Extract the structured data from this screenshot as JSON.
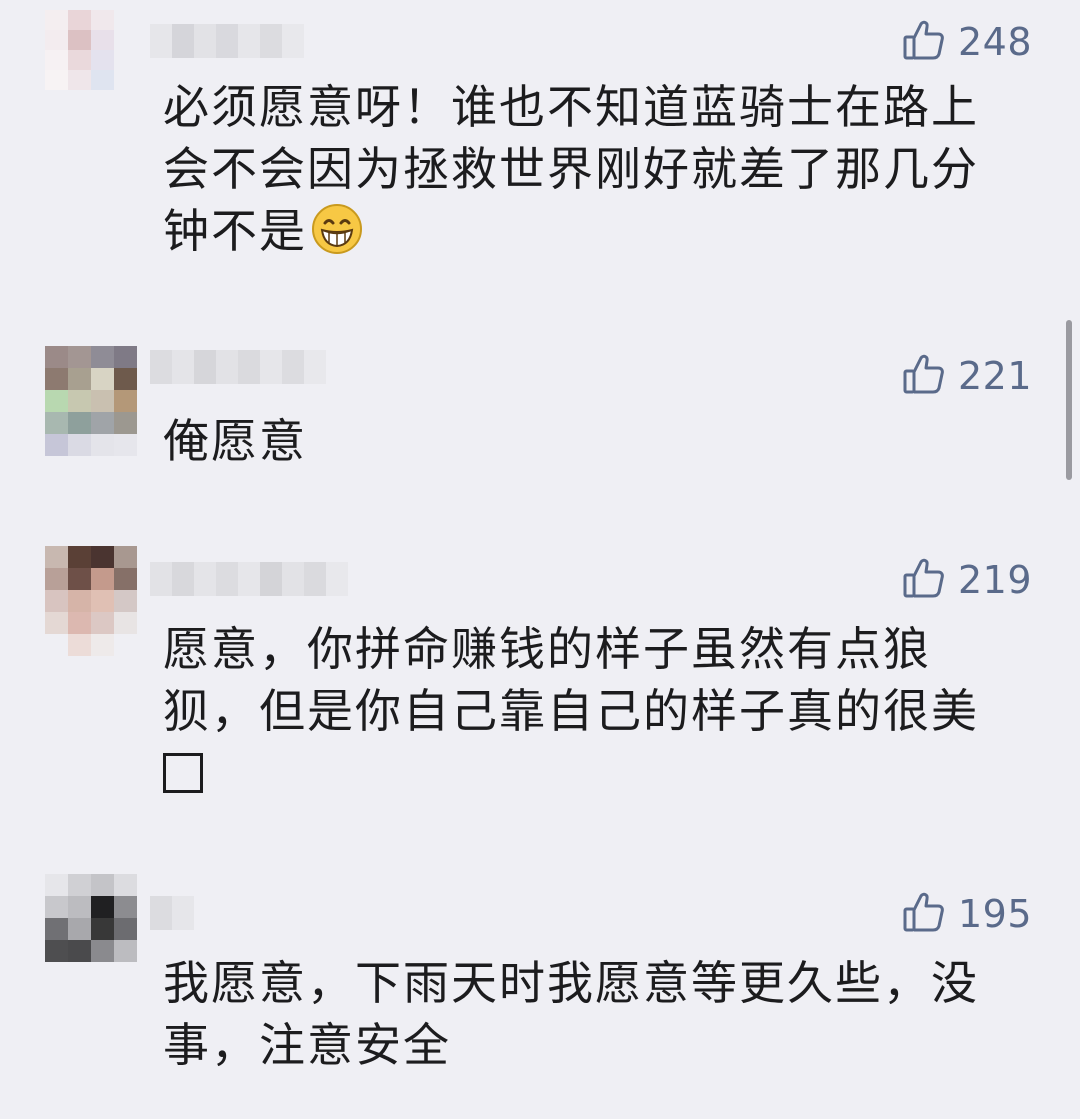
{
  "comments": [
    {
      "likes": "248",
      "text": "必须愿意呀！谁也不知道蓝骑士在路上\n会不会因为拯救世界刚好就差了那几分\n钟不是",
      "emoji": "grinning-face"
    },
    {
      "likes": "221",
      "text": "俺愿意"
    },
    {
      "likes": "219",
      "text": "愿意，你拼命赚钱的样子虽然有点狼\n狈，但是你自己靠自己的样子真的很美"
    },
    {
      "likes": "195",
      "text": "我愿意，下雨天时我愿意等更久些，没\n事，注意安全"
    }
  ],
  "icons": {
    "like": "thumbs-up-icon",
    "emoji": "grinning-face-icon",
    "missing_glyph": "box-glyph"
  },
  "colors": {
    "background": "#efeff4",
    "text": "#1c1c1e",
    "like": "#5a6a8a"
  }
}
